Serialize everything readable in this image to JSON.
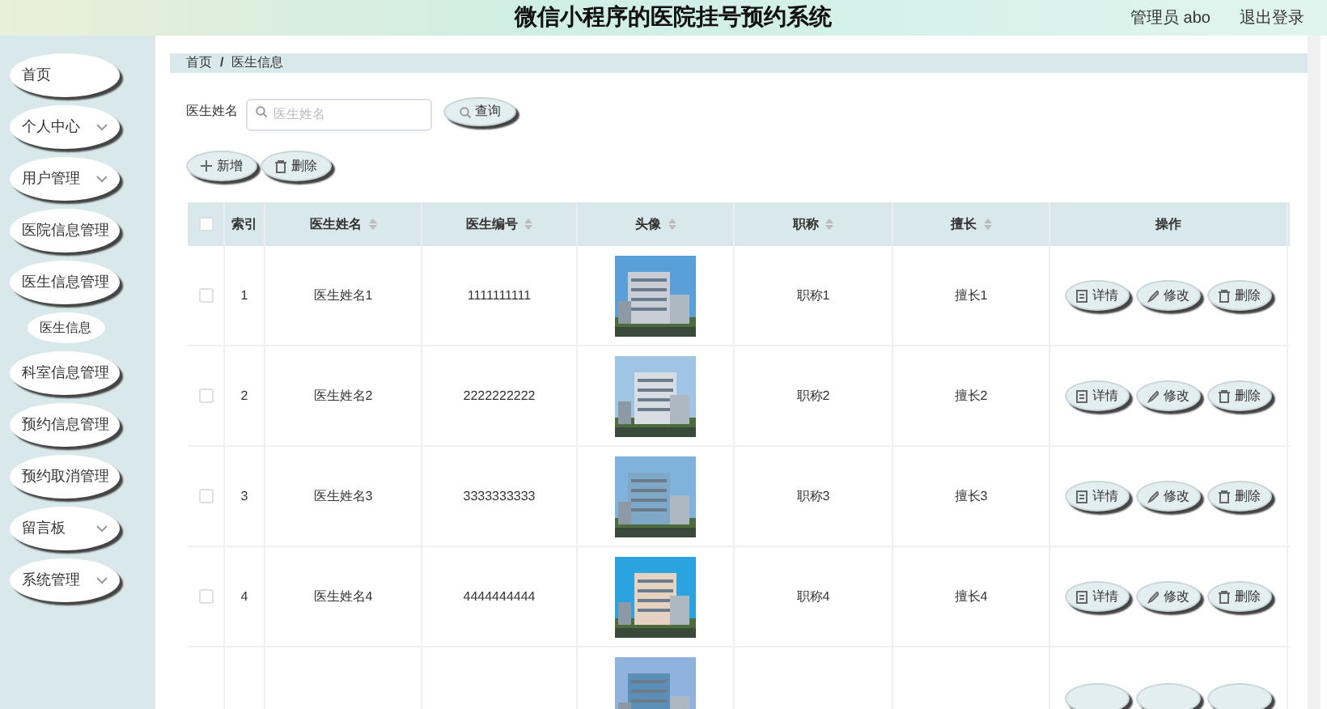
{
  "header": {
    "title": "微信小程序的医院挂号预约系统",
    "user": "管理员 abo",
    "logout": "退出登录"
  },
  "sidebar": {
    "items": [
      {
        "label": "首页",
        "expandable": false
      },
      {
        "label": "个人中心",
        "expandable": true
      },
      {
        "label": "用户管理",
        "expandable": true
      },
      {
        "label": "医院信息管理",
        "expandable": false
      },
      {
        "label": "医生信息管理",
        "expandable": false,
        "children": [
          {
            "label": "医生信息"
          }
        ]
      },
      {
        "label": "科室信息管理",
        "expandable": false
      },
      {
        "label": "预约信息管理",
        "expandable": false
      },
      {
        "label": "预约取消管理",
        "expandable": false
      },
      {
        "label": "留言板",
        "expandable": true
      },
      {
        "label": "系统管理",
        "expandable": true
      }
    ]
  },
  "breadcrumb": [
    "首页",
    "/",
    "医生信息"
  ],
  "search": {
    "label": "医生姓名",
    "placeholder": "医生姓名",
    "button": "查询"
  },
  "actions": [
    "新增",
    "删除"
  ],
  "table": {
    "columns": [
      {
        "label": "索引",
        "sortable": false
      },
      {
        "label": "医生姓名",
        "sortable": true
      },
      {
        "label": "医生编号",
        "sortable": true
      },
      {
        "label": "头像",
        "sortable": true
      },
      {
        "label": "职称",
        "sortable": true
      },
      {
        "label": "擅长",
        "sortable": true
      },
      {
        "label": "操作",
        "sortable": false
      }
    ],
    "header_checked": false,
    "rows": [
      {
        "kind": "full",
        "checked": false,
        "cells": [
          "1",
          "医生姓名1",
          "1111111111",
          "",
          "职称1",
          "擅长1"
        ],
        "buttons": [
          "详情",
          "修改",
          "删除"
        ]
      },
      {
        "kind": "full",
        "checked": false,
        "cells": [
          "2",
          "医生姓名2",
          "2222222222",
          "",
          "职称2",
          "擅长2"
        ],
        "buttons": [
          "详情",
          "修改",
          "删除"
        ]
      },
      {
        "kind": "full",
        "checked": false,
        "cells": [
          "3",
          "医生姓名3",
          "3333333333",
          "",
          "职称3",
          "擅长3"
        ],
        "buttons": [
          "详情",
          "修改",
          "删除"
        ]
      },
      {
        "kind": "full",
        "checked": false,
        "cells": [
          "4",
          "医生姓名4",
          "4444444444",
          "",
          "职称4",
          "擅长4"
        ],
        "buttons": [
          "详情",
          "修改",
          "删除"
        ]
      },
      {
        "kind": "partial"
      }
    ]
  }
}
